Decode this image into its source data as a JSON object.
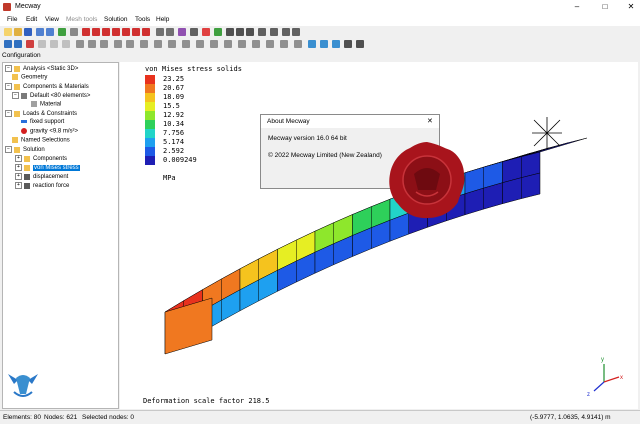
{
  "window": {
    "title": "Mecway"
  },
  "menu": {
    "file": "File",
    "edit": "Edit",
    "view": "View",
    "mesh_tools": "Mesh tools",
    "solution": "Solution",
    "tools": "Tools",
    "help": "Help"
  },
  "panel": {
    "tab": "Configuration"
  },
  "tree": [
    {
      "label": "Analysis <Static 3D>",
      "color": "#f2c14e"
    },
    {
      "label": "Geometry",
      "color": "#f2c14e"
    },
    {
      "label": "Components & Materials",
      "color": "#f2c14e"
    },
    {
      "label": "Default <80 elements>",
      "color": "#7a7a7a"
    },
    {
      "label": "Material",
      "color": "#a0a0a0"
    },
    {
      "label": "Loads & Constraints",
      "color": "#f2c14e"
    },
    {
      "label": "fixed support",
      "color": "#2a6fdb"
    },
    {
      "label": "gravity <9.8 m/s²>",
      "color": "#d42020"
    },
    {
      "label": "Named Selections",
      "color": "#f2c14e"
    },
    {
      "label": "Solution",
      "color": "#f2c14e"
    },
    {
      "label": "Components",
      "color": "#f2c14e"
    },
    {
      "label": "von Mises stress",
      "color": "#f2c14e"
    },
    {
      "label": "displacement",
      "color": "#5a5a5a"
    },
    {
      "label": "reaction force",
      "color": "#5a5a5a"
    }
  ],
  "legend": {
    "title": "von Mises stress solids",
    "unit": "MPa",
    "values": [
      "23.25",
      "20.67",
      "18.09",
      "15.5",
      "12.92",
      "10.34",
      "7.756",
      "5.174",
      "2.592",
      "0.009249"
    ],
    "colors": [
      "#e8321e",
      "#f07820",
      "#f5c31e",
      "#e6ee23",
      "#8ee72c",
      "#2ed05a",
      "#22d4c8",
      "#1ea0f0",
      "#1e5ae6",
      "#1e1eb4"
    ]
  },
  "deformation": {
    "label": "Deformation scale factor 218.5"
  },
  "about": {
    "title": "About Mecway",
    "version": "Mecway version 16.0 64 bit",
    "copyright": "© 2022 Mecway Limited (New Zealand)"
  },
  "status": {
    "elements": "Elements: 80",
    "nodes": "Nodes: 621",
    "selected": "Selected nodes: 0",
    "coords": "(-5.9777, 1.0635, 4.9141) m"
  },
  "axes": {
    "x": "x",
    "y": "y",
    "z": "z"
  }
}
